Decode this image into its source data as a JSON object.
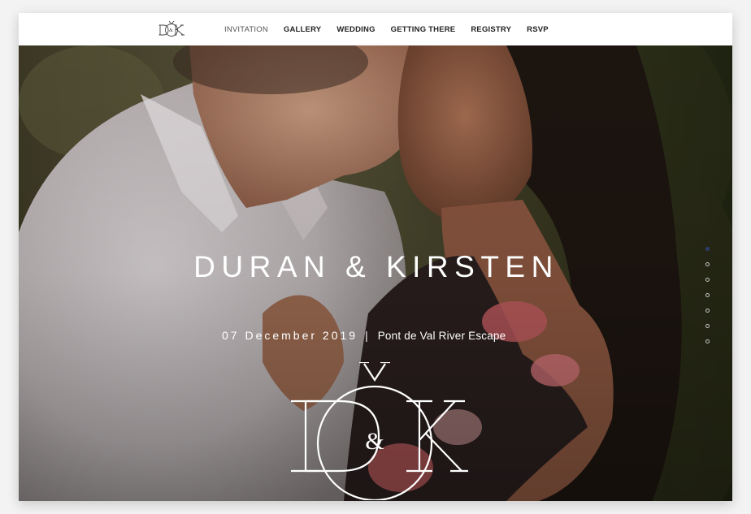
{
  "nav": {
    "logo_text": "D&K",
    "items": [
      {
        "label": "INVITATION",
        "active": true
      },
      {
        "label": "GALLERY",
        "active": false
      },
      {
        "label": "WEDDING",
        "active": false
      },
      {
        "label": "GETTING THERE",
        "active": false
      },
      {
        "label": "REGISTRY",
        "active": false
      },
      {
        "label": "RSVP",
        "active": false
      }
    ]
  },
  "hero": {
    "title": "DURAN & KIRSTEN",
    "date": "07 December 2019",
    "separator": "|",
    "venue": "Pont de Val River Escape",
    "monogram_text": "D&K"
  },
  "colors": {
    "accent": "#2b3d6e",
    "text_light": "#ffffff",
    "nav_text": "#222222"
  },
  "section_dots": {
    "count": 7,
    "active_index": 0
  }
}
